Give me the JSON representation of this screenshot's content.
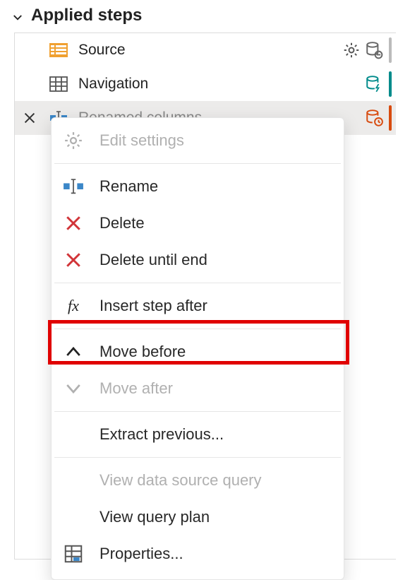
{
  "panel": {
    "title": "Applied steps"
  },
  "steps": [
    {
      "label": "Source"
    },
    {
      "label": "Navigation"
    },
    {
      "label": "Renamed columns"
    }
  ],
  "context_menu": {
    "edit_settings": "Edit settings",
    "rename": "Rename",
    "delete": "Delete",
    "delete_until_end": "Delete until end",
    "insert_step_after": "Insert step after",
    "move_before": "Move before",
    "move_after": "Move after",
    "extract_previous": "Extract previous...",
    "view_data_source_query": "View data source query",
    "view_query_plan": "View query plan",
    "properties": "Properties..."
  }
}
